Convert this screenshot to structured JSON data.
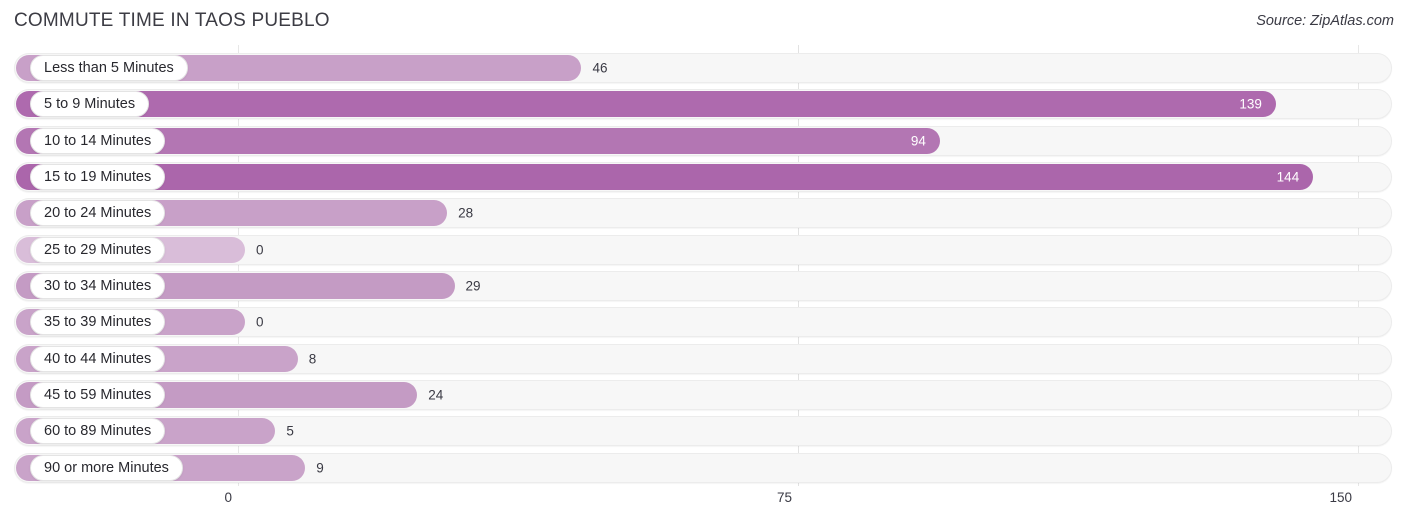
{
  "header": {
    "title": "COMMUTE TIME IN TAOS PUEBLO",
    "source": "Source: ZipAtlas.com"
  },
  "axis": {
    "ticks": [
      "0",
      "75",
      "150"
    ],
    "min": 0,
    "max": 150
  },
  "chart_data": {
    "type": "bar",
    "orientation": "horizontal",
    "title": "COMMUTE TIME IN TAOS PUEBLO",
    "xlabel": "",
    "ylabel": "",
    "xlim": [
      0,
      150
    ],
    "grid": true,
    "legend": "none",
    "source": "Source: ZipAtlas.com",
    "categories": [
      "Less than 5 Minutes",
      "5 to 9 Minutes",
      "10 to 14 Minutes",
      "15 to 19 Minutes",
      "20 to 24 Minutes",
      "25 to 29 Minutes",
      "30 to 34 Minutes",
      "35 to 39 Minutes",
      "40 to 44 Minutes",
      "45 to 59 Minutes",
      "60 to 89 Minutes",
      "90 or more Minutes"
    ],
    "values": [
      46,
      139,
      94,
      144,
      28,
      0,
      29,
      0,
      8,
      24,
      5,
      9
    ],
    "tick_labels": [
      "0",
      "75",
      "150"
    ]
  },
  "rows": [
    {
      "label": "Less than 5 Minutes",
      "value": 46,
      "display": "46",
      "color": "#c8a0c8",
      "inside": false
    },
    {
      "label": "5 to 9 Minutes",
      "value": 139,
      "display": "139",
      "color": "#ae6aae",
      "inside": true
    },
    {
      "label": "10 to 14 Minutes",
      "value": 94,
      "display": "94",
      "color": "#b376b3",
      "inside": true
    },
    {
      "label": "15 to 19 Minutes",
      "value": 144,
      "display": "144",
      "color": "#ab66ab",
      "inside": true
    },
    {
      "label": "20 to 24 Minutes",
      "value": 28,
      "display": "28",
      "color": "#c8a0c8",
      "inside": false
    },
    {
      "label": "25 to 29 Minutes",
      "value": 0,
      "display": "0",
      "color": "#d9bdd9",
      "inside": false
    },
    {
      "label": "30 to 34 Minutes",
      "value": 29,
      "display": "29",
      "color": "#c49bc4",
      "inside": false
    },
    {
      "label": "35 to 39 Minutes",
      "value": 0,
      "display": "0",
      "color": "#c9a3c9",
      "inside": false
    },
    {
      "label": "40 to 44 Minutes",
      "value": 8,
      "display": "8",
      "color": "#c9a3c9",
      "inside": false
    },
    {
      "label": "45 to 59 Minutes",
      "value": 24,
      "display": "24",
      "color": "#c49bc4",
      "inside": false
    },
    {
      "label": "60 to 89 Minutes",
      "value": 5,
      "display": "5",
      "color": "#c9a3c9",
      "inside": false
    },
    {
      "label": "90 or more Minutes",
      "value": 9,
      "display": "9",
      "color": "#c9a3c9",
      "inside": false
    }
  ],
  "colors": {
    "track": "#f7f7f7",
    "grid": "#e2e2e2",
    "text": "#3a3a44",
    "bar_light": "#d9bdd9",
    "bar_mid": "#c9a3c9",
    "bar_dark": "#ab66ab"
  }
}
